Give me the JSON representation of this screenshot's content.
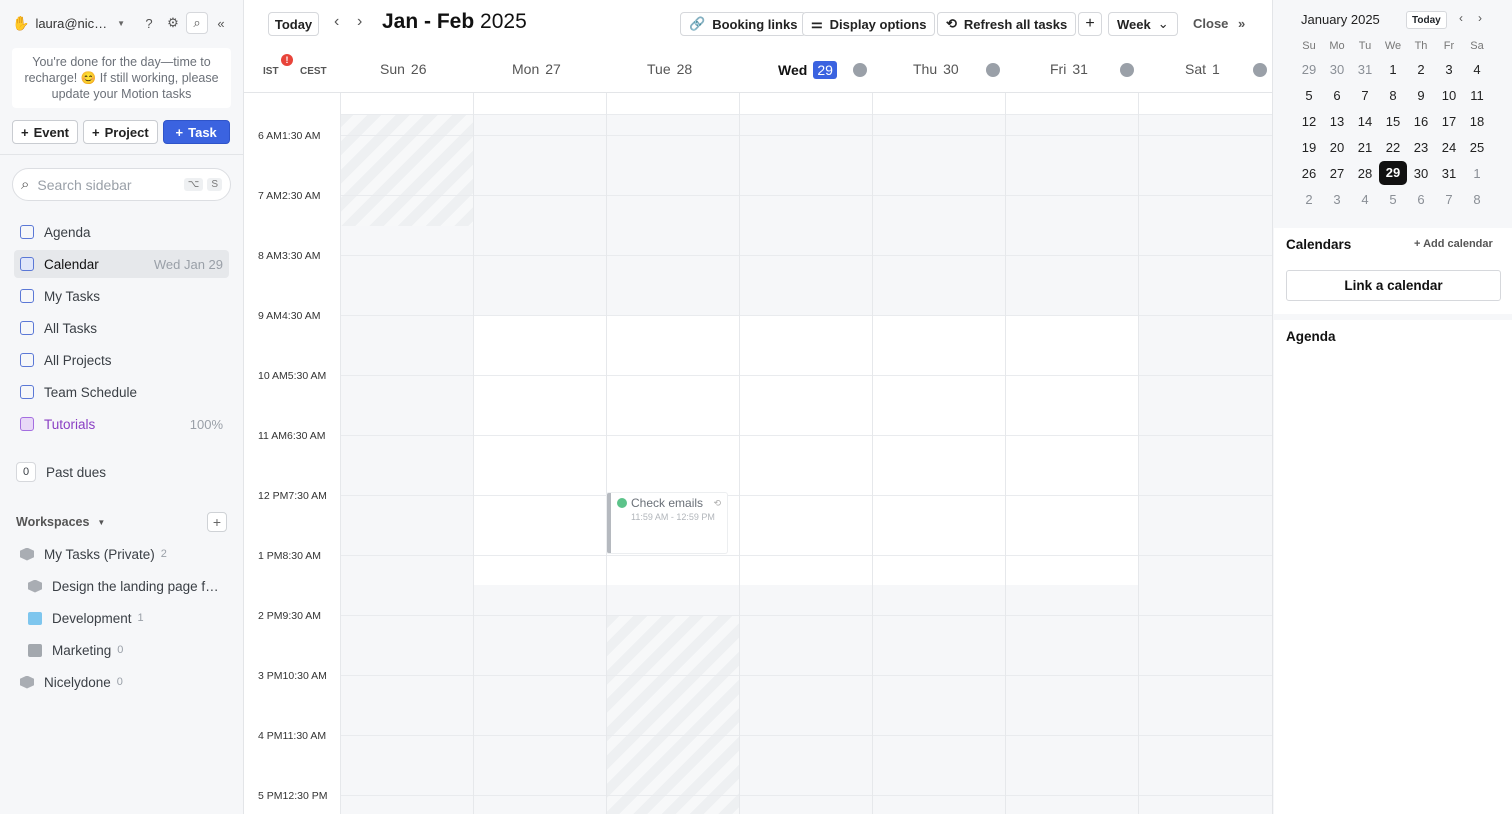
{
  "sidebar": {
    "account": "laura@nic…",
    "notice": "You're done for the day—time to recharge! 😊 If still working, please update your Motion tasks",
    "add_buttons": {
      "event": "Event",
      "project": "Project",
      "task": "Task"
    },
    "search": {
      "placeholder": "Search sidebar",
      "shortcut1": "⌥",
      "shortcut2": "S"
    },
    "nav": [
      {
        "label": "Agenda",
        "meta": ""
      },
      {
        "label": "Calendar",
        "meta": "Wed Jan 29"
      },
      {
        "label": "My Tasks",
        "meta": ""
      },
      {
        "label": "All Tasks",
        "meta": ""
      },
      {
        "label": "All Projects",
        "meta": ""
      },
      {
        "label": "Team Schedule",
        "meta": ""
      },
      {
        "label": "Tutorials",
        "meta": "100%"
      }
    ],
    "past_dues": {
      "count": "0",
      "label": "Past dues"
    },
    "workspaces_label": "Workspaces",
    "workspaces": [
      {
        "label": "My Tasks (Private)",
        "count": "2"
      },
      {
        "label": "Design the landing page f…",
        "count": ""
      },
      {
        "label": "Development",
        "count": "1"
      },
      {
        "label": "Marketing",
        "count": "0"
      },
      {
        "label": "Nicelydone",
        "count": "0"
      }
    ]
  },
  "header": {
    "today": "Today",
    "range_bold": "Jan - Feb",
    "range_year": "2025",
    "booking": "Booking links",
    "display": "Display options",
    "refresh": "Refresh all tasks",
    "view": "Week",
    "close": "Close"
  },
  "timezones": {
    "primary": "IST",
    "secondary": "CEST",
    "alert": "!"
  },
  "days": [
    {
      "name": "Sun",
      "num": "26"
    },
    {
      "name": "Mon",
      "num": "27"
    },
    {
      "name": "Tue",
      "num": "28"
    },
    {
      "name": "Wed",
      "num": "29"
    },
    {
      "name": "Thu",
      "num": "30"
    },
    {
      "name": "Fri",
      "num": "31"
    },
    {
      "name": "Sat",
      "num": "1"
    }
  ],
  "times": [
    {
      "primary": "6 AM",
      "secondary": "1:30 AM"
    },
    {
      "primary": "7 AM",
      "secondary": "2:30 AM"
    },
    {
      "primary": "8 AM",
      "secondary": "3:30 AM"
    },
    {
      "primary": "9 AM",
      "secondary": "4:30 AM"
    },
    {
      "primary": "10 AM",
      "secondary": "5:30 AM"
    },
    {
      "primary": "11 AM",
      "secondary": "6:30 AM"
    },
    {
      "primary": "12 PM",
      "secondary": "7:30 AM"
    },
    {
      "primary": "1 PM",
      "secondary": "8:30 AM"
    },
    {
      "primary": "2 PM",
      "secondary": "9:30 AM"
    },
    {
      "primary": "3 PM",
      "secondary": "10:30 AM"
    },
    {
      "primary": "4 PM",
      "secondary": "11:30 AM"
    },
    {
      "primary": "5 PM",
      "secondary": "12:30 PM"
    }
  ],
  "event": {
    "title": "Check emails",
    "time": "11:59 AM - 12:59 PM"
  },
  "mini_calendar": {
    "month": "January 2025",
    "today": "Today",
    "weekdays": [
      "Su",
      "Mo",
      "Tu",
      "We",
      "Th",
      "Fr",
      "Sa"
    ],
    "weeks": [
      [
        "29",
        "30",
        "31",
        "1",
        "2",
        "3",
        "4"
      ],
      [
        "5",
        "6",
        "7",
        "8",
        "9",
        "10",
        "11"
      ],
      [
        "12",
        "13",
        "14",
        "15",
        "16",
        "17",
        "18"
      ],
      [
        "19",
        "20",
        "21",
        "22",
        "23",
        "24",
        "25"
      ],
      [
        "26",
        "27",
        "28",
        "29",
        "30",
        "31",
        "1"
      ],
      [
        "2",
        "3",
        "4",
        "5",
        "6",
        "7",
        "8"
      ]
    ]
  },
  "calendars": {
    "title": "Calendars",
    "add": "Add calendar",
    "link": "Link a calendar"
  },
  "agenda": {
    "title": "Agenda"
  }
}
